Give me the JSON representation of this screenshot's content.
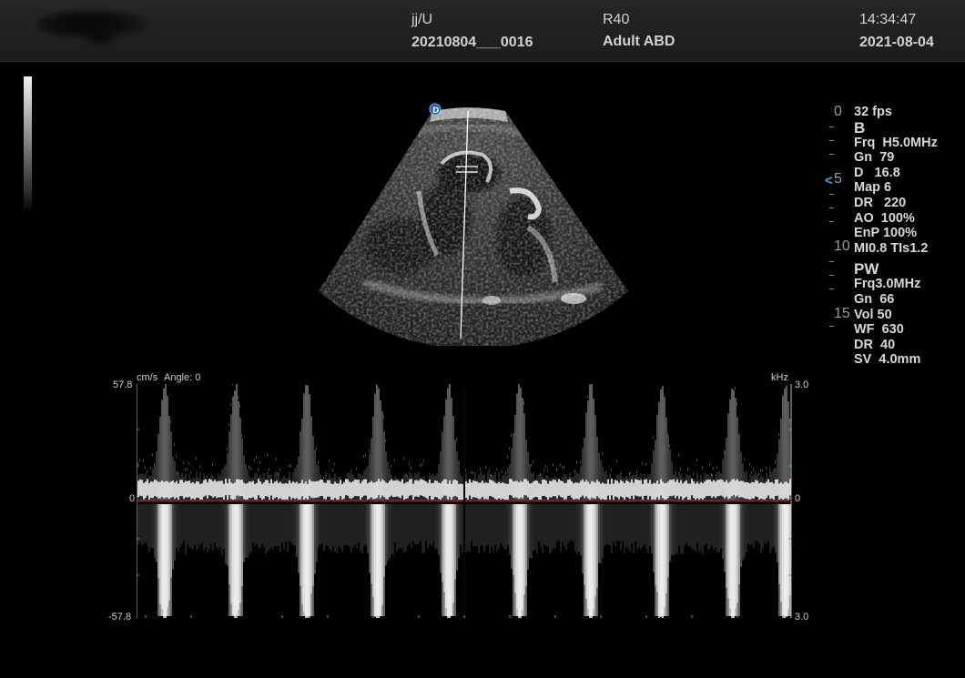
{
  "header": {
    "patient_id": "jj/U",
    "exam_id": "20210804___0016",
    "probe": "R40",
    "preset": "Adult ABD",
    "time": "14:34:47",
    "date": "2021-08-04"
  },
  "depth_scale": {
    "labels": [
      "0",
      "5",
      "10",
      "15"
    ],
    "focus_icon": "focus-marker-icon"
  },
  "bmode_params": {
    "mode": "B",
    "lines": [
      "32 fps",
      "Frq  H5.0MHz",
      "Gn  79",
      "D   16.8",
      "Map 6",
      "DR   220",
      "AO  100%",
      "EnP 100%",
      "MI0.8 TIs1.2"
    ]
  },
  "pw_params": {
    "mode": "PW",
    "lines": [
      "Frq3.0MHz",
      "Gn  66",
      "Vol 50",
      "WF  630",
      "DR  40",
      "SV  4.0mm"
    ]
  },
  "doppler": {
    "velocity_unit": "cm/s",
    "angle_text": "Angle: 0",
    "freq_unit": "kHz",
    "left_top": "57.8",
    "left_zero": "0",
    "left_bottom": "-57.8",
    "right_top": "3.0",
    "right_zero": "0",
    "right_bottom": "3.0"
  },
  "colors": {
    "background": "#000000",
    "header": "#222222",
    "focus_marker": "#4aa3d9",
    "baseline": "#8a1a1a",
    "spectrum": "#ffffff"
  }
}
